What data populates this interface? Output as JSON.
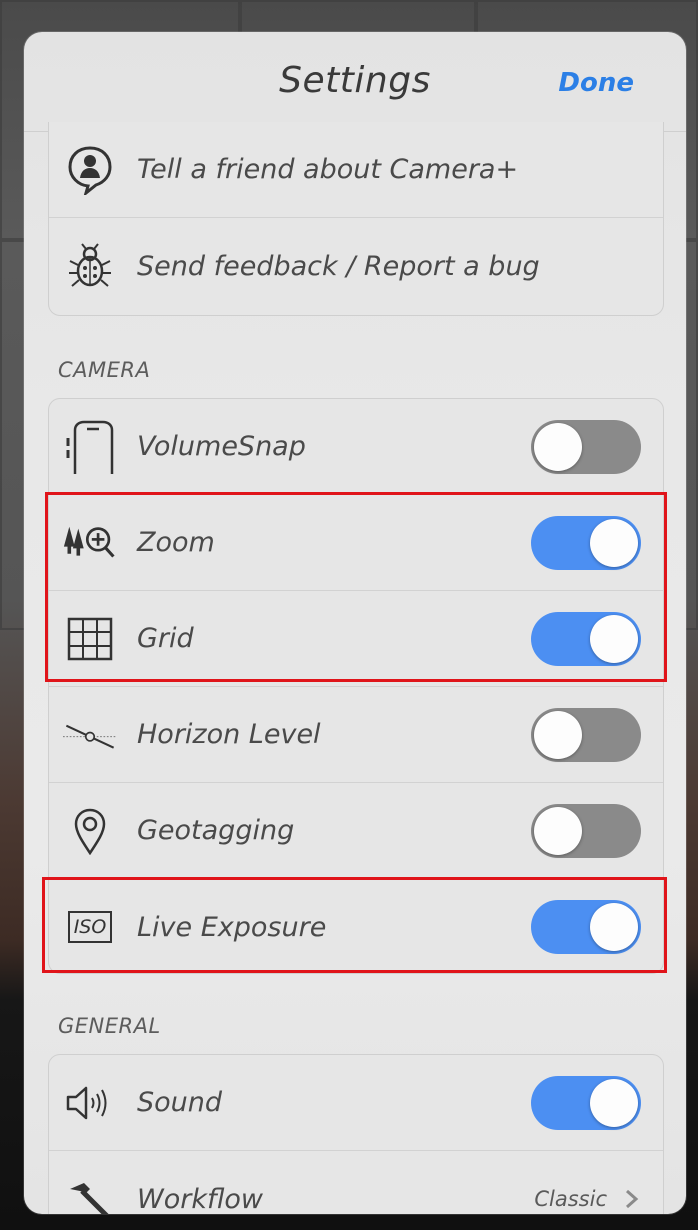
{
  "header": {
    "title": "Settings",
    "done_label": "Done"
  },
  "social": {
    "items": [
      {
        "label": "Tell a friend about Camera+",
        "icon": "speech-person-icon"
      },
      {
        "label": "Send feedback / Report a bug",
        "icon": "bug-icon"
      }
    ]
  },
  "camera": {
    "section_label": "CAMERA",
    "items": [
      {
        "label": "VolumeSnap",
        "icon": "phone-volume-icon",
        "on": false
      },
      {
        "label": "Zoom",
        "icon": "zoom-trees-icon",
        "on": true
      },
      {
        "label": "Grid",
        "icon": "grid-icon",
        "on": true
      },
      {
        "label": "Horizon Level",
        "icon": "horizon-level-icon",
        "on": false
      },
      {
        "label": "Geotagging",
        "icon": "location-pin-icon",
        "on": false
      },
      {
        "label": "Live Exposure",
        "icon": "iso-icon",
        "on": true
      }
    ]
  },
  "general": {
    "section_label": "GENERAL",
    "items": [
      {
        "label": "Sound",
        "icon": "speaker-icon",
        "on": true
      },
      {
        "label": "Workflow",
        "icon": "hammer-icon",
        "value": "Classic"
      }
    ]
  },
  "iso_text": "ISO",
  "colors": {
    "accent": "#2b7fe6",
    "toggle_on": "#4c8ff2",
    "toggle_off": "#8a8a8a",
    "highlight": "#e0141a"
  }
}
